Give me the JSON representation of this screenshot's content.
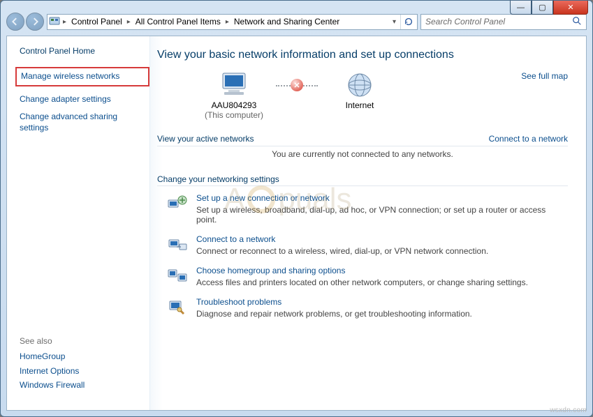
{
  "window": {
    "min": "—",
    "max": "▢",
    "close": "✕"
  },
  "breadcrumbs": {
    "b0": "Control Panel",
    "b1": "All Control Panel Items",
    "b2": "Network and Sharing Center"
  },
  "search": {
    "placeholder": "Search Control Panel"
  },
  "sidebar": {
    "home": "Control Panel Home",
    "l0": "Manage wireless networks",
    "l1": "Change adapter settings",
    "l2": "Change advanced sharing settings",
    "seehdr": "See also",
    "s0": "HomeGroup",
    "s1": "Internet Options",
    "s2": "Windows Firewall"
  },
  "main": {
    "title": "View your basic network information and set up connections",
    "seefull": "See full map",
    "node0": "AAU804293",
    "node0sub": "(This computer)",
    "node1": "Internet",
    "activehdr": "View your active networks",
    "connectlink": "Connect to a network",
    "notconn": "You are currently not connected to any networks.",
    "changehdr": "Change your networking settings",
    "opts": {
      "o0t": "Set up a new connection or network",
      "o0d": "Set up a wireless, broadband, dial-up, ad hoc, or VPN connection; or set up a router or access point.",
      "o1t": "Connect to a network",
      "o1d": "Connect or reconnect to a wireless, wired, dial-up, or VPN network connection.",
      "o2t": "Choose homegroup and sharing options",
      "o2d": "Access files and printers located on other network computers, or change sharing settings.",
      "o3t": "Troubleshoot problems",
      "o3d": "Diagnose and repair network problems, or get troubleshooting information."
    }
  },
  "watermark": "wsxdn.com"
}
